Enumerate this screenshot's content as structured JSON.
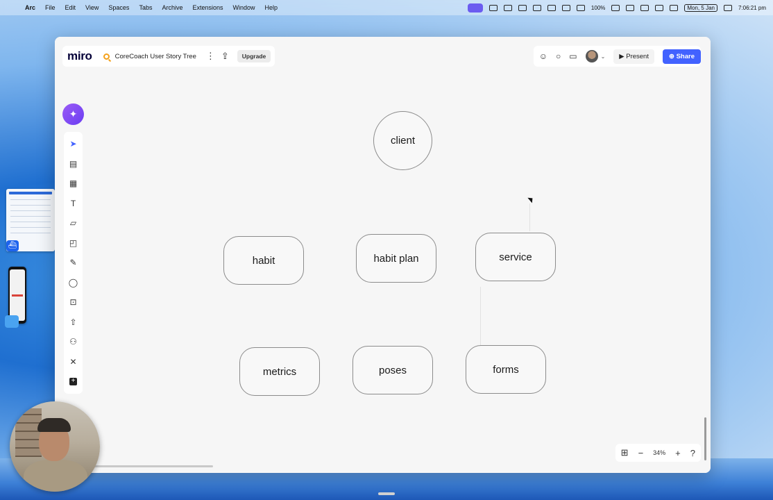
{
  "menubar": {
    "app": "Arc",
    "items": [
      "File",
      "Edit",
      "View",
      "Spaces",
      "Tabs",
      "Archive",
      "Extensions",
      "Window",
      "Help"
    ],
    "battery": "100%",
    "date": "Mon, 5 Jan",
    "time": "7:06:21 pm"
  },
  "board": {
    "logo": "miro",
    "title": "CoreCoach User Story Tree",
    "upgrade_label": "Upgrade",
    "present_label": "Present",
    "share_label": "Share"
  },
  "nodes": {
    "client": "client",
    "habit": "habit",
    "habit_plan": "habit plan",
    "service": "service",
    "metrics": "metrics",
    "poses": "poses",
    "forms": "forms"
  },
  "zoom": {
    "level": "34%"
  },
  "colors": {
    "accent": "#4262ff",
    "ai_button": "#7b4cf4",
    "search_icon": "#f4a019"
  }
}
